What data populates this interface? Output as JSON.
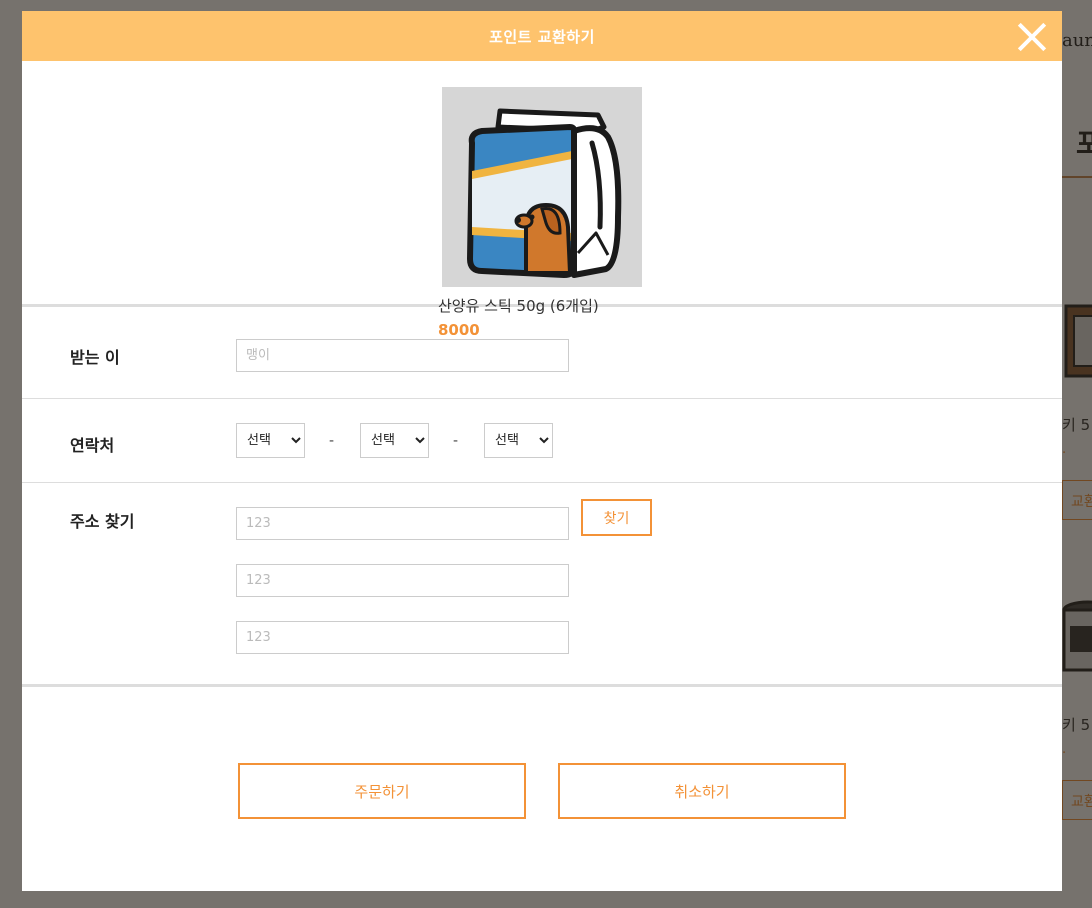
{
  "background": {
    "brand_fragment": "auni",
    "heading_fragment": "포",
    "products": [
      {
        "name_fragment": "키 5",
        "price_fragment": "·",
        "button_fragment": "교환"
      },
      {
        "name_fragment": "키 5",
        "price_fragment": "·",
        "button_fragment": "교환"
      }
    ]
  },
  "modal": {
    "title": "포인트 교환하기",
    "close_icon": "close-icon"
  },
  "product": {
    "name": "산양유 스틱 50g (6개입)",
    "price": "8000",
    "image_icon": "milk-carton-dog-illustration"
  },
  "form": {
    "recipient": {
      "label": "받는 이",
      "placeholder": "맹이"
    },
    "phone": {
      "label": "연락처",
      "select_1": "선택",
      "select_2": "선택",
      "select_3": "선택",
      "separator": "-"
    },
    "address": {
      "label": "주소 찾기",
      "find_button": "찾기",
      "line1_placeholder": "123",
      "line2_placeholder": "123",
      "line3_placeholder": "123"
    }
  },
  "actions": {
    "order_label": "주문하기",
    "cancel_label": "취소하기"
  },
  "colors": {
    "header": "#fec36d",
    "accent": "#f39237",
    "overlay": "#6b635b"
  }
}
